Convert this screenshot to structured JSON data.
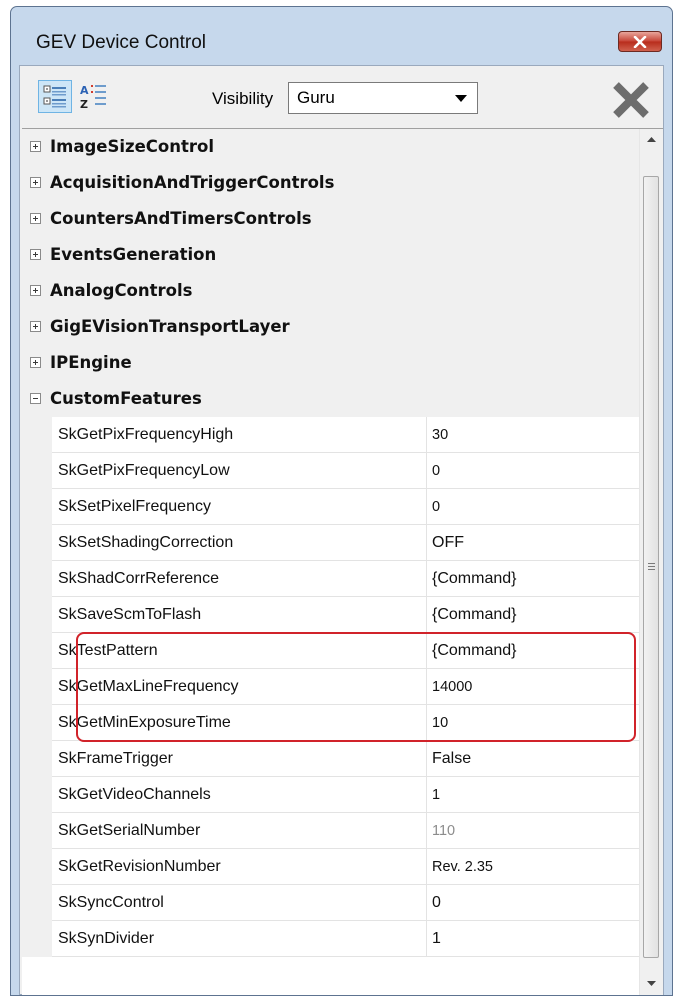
{
  "window": {
    "title": "GEV Device Control"
  },
  "toolbar": {
    "visibility_label": "Visibility",
    "visibility_value": "Guru"
  },
  "categories": [
    {
      "label": "ImageSizeControl",
      "expanded": false
    },
    {
      "label": "AcquisitionAndTriggerControls",
      "expanded": false
    },
    {
      "label": "CountersAndTimersControls",
      "expanded": false
    },
    {
      "label": "EventsGeneration",
      "expanded": false
    },
    {
      "label": "AnalogControls",
      "expanded": false
    },
    {
      "label": "GigEVisionTransportLayer",
      "expanded": false
    },
    {
      "label": "IPEngine",
      "expanded": false
    },
    {
      "label": "CustomFeatures",
      "expanded": true
    }
  ],
  "properties": [
    {
      "name": "SkGetPixFrequencyHigh",
      "value": "30"
    },
    {
      "name": "SkGetPixFrequencyLow",
      "value": "0"
    },
    {
      "name": "SkSetPixelFrequency",
      "value": "0"
    },
    {
      "name": "SkSetShadingCorrection",
      "value": "OFF"
    },
    {
      "name": "SkShadCorrReference",
      "value": "{Command}"
    },
    {
      "name": "SkSaveScmToFlash",
      "value": "{Command}"
    },
    {
      "name": "SkTestPattern",
      "value": "{Command}"
    },
    {
      "name": "SkGetMaxLineFrequency",
      "value": "14000"
    },
    {
      "name": "SkGetMinExposureTime",
      "value": "10"
    },
    {
      "name": "SkFrameTrigger",
      "value": "False"
    },
    {
      "name": "SkGetVideoChannels",
      "value": "1"
    },
    {
      "name": "SkGetSerialNumber",
      "value": "110"
    },
    {
      "name": "SkGetRevisionNumber",
      "value": "Rev. 2.35"
    },
    {
      "name": "SkSyncControl",
      "value": "0"
    },
    {
      "name": "SkSynDivider",
      "value": "1"
    }
  ],
  "colors": {
    "highlight": "#d1232a",
    "titlebar": "#c6d8ec",
    "close_button": "#c74638",
    "readonly_value": "#8c8c8c"
  }
}
